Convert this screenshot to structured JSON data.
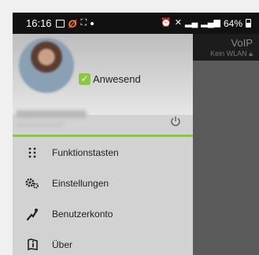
{
  "statusbar": {
    "time": "16:16",
    "battery_percent": "64%"
  },
  "app": {
    "voip_label": "VoIP",
    "wlan_label": "Kein WLAN"
  },
  "drawer": {
    "presence_status": "Anwesend",
    "menu": [
      {
        "label": "Funktionstasten",
        "icon": "keypad-icon"
      },
      {
        "label": "Einstellungen",
        "icon": "settings-gears-icon"
      },
      {
        "label": "Benutzerkonto",
        "icon": "user-account-icon"
      },
      {
        "label": "Über",
        "icon": "info-shield-icon"
      }
    ]
  },
  "colors": {
    "accent_green": "#8dc63f",
    "drawer_bg": "#d2d2d2",
    "statusbar_bg": "#111111"
  }
}
